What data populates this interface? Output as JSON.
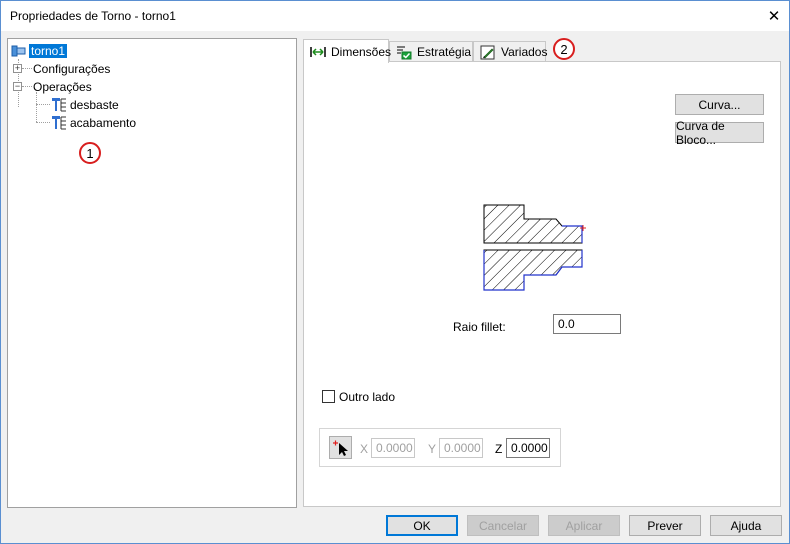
{
  "window": {
    "title": "Propriedades de Torno - torno1",
    "close_glyph": "✕"
  },
  "tree": {
    "root": "torno1",
    "items": [
      {
        "label": "Configurações",
        "expander": "+"
      },
      {
        "label": "Operações",
        "expander": "−"
      }
    ],
    "operations": [
      "desbaste",
      "acabamento"
    ],
    "badge": "1"
  },
  "tabs": [
    {
      "label": "Dimensões",
      "icon": "dimension-arrows-icon"
    },
    {
      "label": "Estratégia",
      "icon": "strategy-check-icon"
    },
    {
      "label": "Variados",
      "icon": "pencil-icon"
    }
  ],
  "tabs_badge": "2",
  "dimensions": {
    "curva_button": "Curva...",
    "curva_bloco_button": "Curva de Bloco...",
    "raio_fillet_label": "Raio fillet:",
    "raio_fillet_value": "0.0",
    "outro_lado_label": "Outro lado",
    "outro_lado_checked": false,
    "x_label": "X",
    "x_value": "0.0000",
    "y_label": "Y",
    "y_value": "0.0000",
    "z_label": "Z",
    "z_value": "0.0000"
  },
  "footer": {
    "ok": "OK",
    "cancelar": "Cancelar",
    "aplicar": "Aplicar",
    "prever": "Prever",
    "ajuda": "Ajuda"
  },
  "colors": {
    "selection": "#0078d7",
    "badge_ring": "#d81e1e",
    "profile_outline": "#2233cc"
  }
}
